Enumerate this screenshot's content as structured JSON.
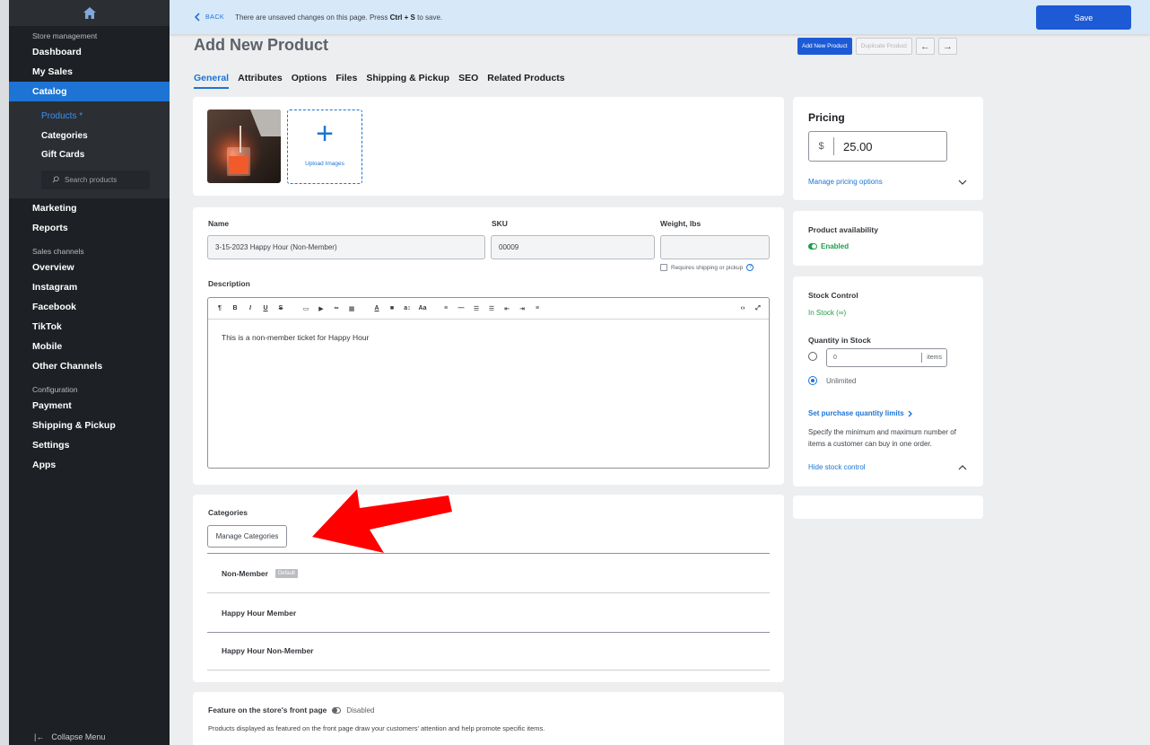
{
  "sidebar": {
    "store_management": "Store management",
    "dashboard": "Dashboard",
    "my_sales": "My Sales",
    "catalog": "Catalog",
    "catalog_sub": {
      "products": "Products *",
      "categories": "Categories",
      "gift_cards": "Gift Cards",
      "search_placeholder": "Search products"
    },
    "marketing": "Marketing",
    "reports": "Reports",
    "sales_channels": "Sales channels",
    "overview": "Overview",
    "instagram": "Instagram",
    "facebook": "Facebook",
    "tiktok": "TikTok",
    "mobile": "Mobile",
    "other_channels": "Other Channels",
    "configuration": "Configuration",
    "payment": "Payment",
    "shipping": "Shipping & Pickup",
    "settings": "Settings",
    "apps": "Apps",
    "collapse": "Collapse Menu"
  },
  "topbar": {
    "back": "BACK",
    "unsaved_prefix": "There are unsaved changes on this page. Press",
    "shortcut": "Ctrl + S",
    "unsaved_suffix": "to save.",
    "save": "Save"
  },
  "header": {
    "title": "Add New Product",
    "add_new": "Add New Product",
    "duplicate": "Duplicate Product"
  },
  "tabs": [
    "General",
    "Attributes",
    "Options",
    "Files",
    "Shipping & Pickup",
    "SEO",
    "Related Products"
  ],
  "images": {
    "upload_label": "Upload Images"
  },
  "details": {
    "name_label": "Name",
    "name_value": "3-15-2023  Happy Hour (Non-Member)",
    "sku_label": "SKU",
    "sku_value": "00009",
    "weight_label": "Weight, lbs",
    "weight_value": "",
    "requires_shipping": "Requires shipping or pickup",
    "description_label": "Description",
    "description_text": "This is a non-member ticket for Happy Hour"
  },
  "categories": {
    "label": "Categories",
    "manage": "Manage Categories",
    "items": [
      {
        "name": "Non-Member",
        "badge": "Default"
      },
      {
        "name": "Happy Hour Member",
        "badge": ""
      },
      {
        "name": "Happy Hour Non-Member",
        "badge": ""
      }
    ]
  },
  "feature": {
    "label": "Feature on the store's front page",
    "state": "Disabled",
    "help": "Products displayed as featured on the front page draw your customers' attention and help promote specific items."
  },
  "pricing": {
    "title": "Pricing",
    "currency": "$",
    "price": "25.00",
    "manage": "Manage pricing options"
  },
  "availability": {
    "label": "Product availability",
    "state": "Enabled"
  },
  "stock": {
    "label": "Stock Control",
    "status": "In Stock (∞)",
    "qty_label": "Quantity in Stock",
    "qty_value": "0",
    "qty_unit": "items",
    "unlimited": "Unlimited",
    "limits_link": "Set purchase quantity limits",
    "limits_help": "Specify the minimum and maximum number of items a customer can buy in one order.",
    "hide": "Hide stock control"
  },
  "colors": {
    "accent": "#1d74d4",
    "primary_button": "#1d5bd6",
    "sidebar_bg": "#1d2024",
    "enabled_green": "#1f9d4a",
    "annotation_arrow": "#ff0000"
  }
}
